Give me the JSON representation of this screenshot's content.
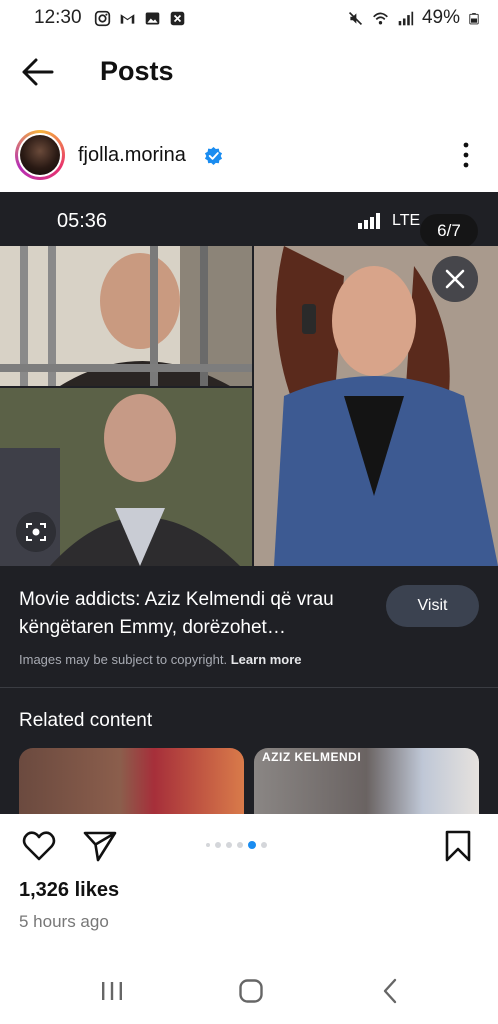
{
  "status_bar": {
    "time": "12:30",
    "battery": "49%",
    "icons_left": [
      "instagram-icon",
      "gmail-icon",
      "gallery-icon",
      "close-notification-icon"
    ],
    "icons_right": [
      "mute-icon",
      "wifi-icon",
      "signal-icon",
      "battery-icon"
    ]
  },
  "header": {
    "title": "Posts",
    "back_icon": "arrow-left-icon"
  },
  "post": {
    "author": "fjolla.morina",
    "verified": true,
    "more_icon": "more-vertical-icon",
    "image": {
      "phone_time": "05:36",
      "phone_network": "LTE",
      "counter": "6/7",
      "caption": "Movie addicts: Aziz Kelmendi që vrau këngëtaren Emmy, dorëzohet…",
      "visit_label": "Visit",
      "copyright_text": "Images may be subject to copyright.",
      "learn_more": "Learn more",
      "related_title": "Related content",
      "related_card_label": "AZIZ KELMENDI"
    },
    "carousel": {
      "count": 6,
      "active_index": 4
    },
    "likes": "1,326 likes",
    "time_ago": "5 hours ago"
  },
  "colors": {
    "accent_blue": "#1a8cf0",
    "image_bg": "#1f2025",
    "visit_bg": "#3b4250"
  }
}
